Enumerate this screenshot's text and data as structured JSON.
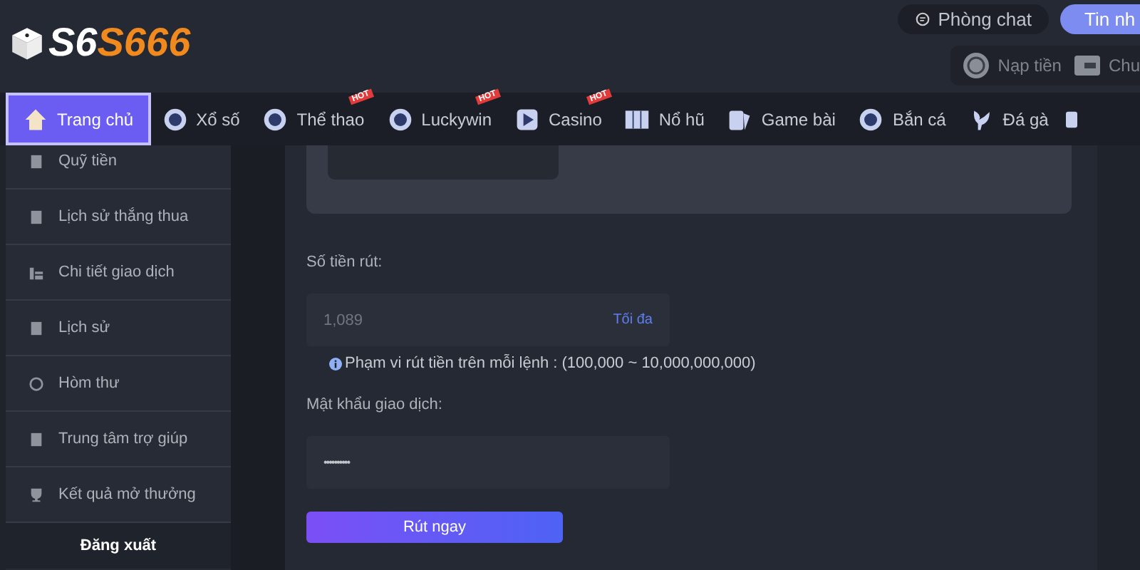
{
  "logo": {
    "dice_text": "S6",
    "brand_text": "S666"
  },
  "header_actions": [
    {
      "kind": "chat",
      "label": "Phòng chat"
    },
    {
      "kind": "message",
      "label": "Tin nh"
    }
  ],
  "wallet_actions": [
    {
      "kind": "deposit",
      "label": "Nạp tiền"
    },
    {
      "kind": "transfer",
      "label": "Chu"
    }
  ],
  "nav": [
    {
      "label": "Trang chủ",
      "selected": true
    },
    {
      "label": "Xổ số",
      "selected": false
    },
    {
      "label": "Thể thao",
      "selected": false,
      "badge": "HOT"
    },
    {
      "label": "Luckywin",
      "selected": false,
      "badge": "HOT"
    },
    {
      "label": "Casino",
      "selected": false,
      "badge": "HOT"
    },
    {
      "label": "Nổ hũ",
      "selected": false
    },
    {
      "label": "Game bài",
      "selected": false
    },
    {
      "label": "Bắn cá",
      "selected": false
    },
    {
      "label": "Đá gà",
      "selected": false
    }
  ],
  "sidebar": {
    "items": [
      {
        "label": "Quỹ tiền"
      },
      {
        "label": "Lịch sử thắng thua"
      },
      {
        "label": "Chi tiết giao dịch"
      },
      {
        "label": "Lịch sử"
      },
      {
        "label": "Hòm thư"
      },
      {
        "label": "Trung tâm trợ giúp"
      },
      {
        "label": "Kết quả mở thưởng"
      }
    ],
    "logout": "Đăng xuất"
  },
  "form": {
    "amount_label": "Số tiền rút:",
    "amount_placeholder": "1,089",
    "max_link": "Tối đa",
    "range_note": "Phạm vi rút tiền trên mỗi lệnh : (100,000 ~ 10,000,000,000)",
    "password_label": "Mật khẩu giao dịch:",
    "password_value": "••••••••••",
    "submit": "Rút ngay"
  }
}
